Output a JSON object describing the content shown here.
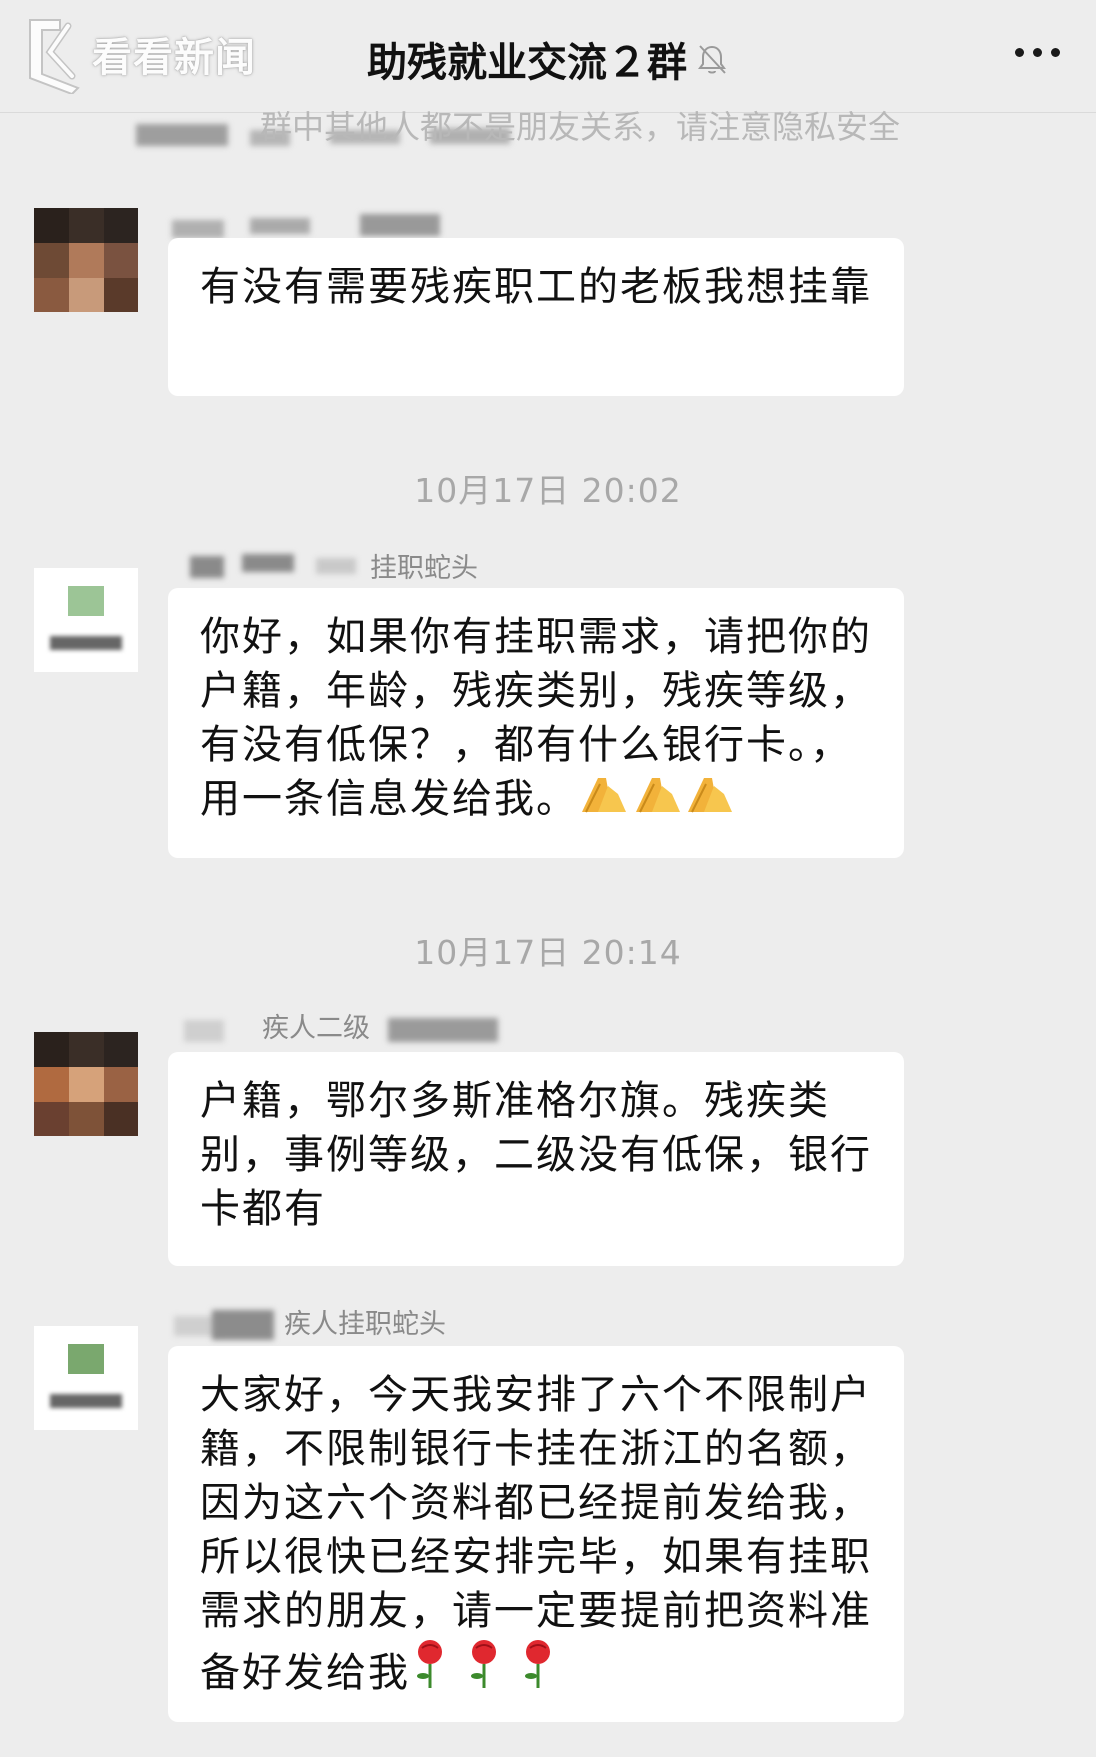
{
  "watermark": {
    "text": "看看新闻"
  },
  "header": {
    "title": "助残就业交流２群"
  },
  "notice": {
    "text": "群中其他人都不是朋友关系，请注意隐私安全"
  },
  "messages": [
    {
      "sender": "",
      "text": "有没有需要残疾职工的老板我想挂靠"
    },
    {
      "timestamp": "10月17日 20:02",
      "sender": "挂职蛇头",
      "text": "你好，如果你有挂职需求，请把你的户籍，年龄，残疾类别，残疾等级，有没有低保？，都有什么银行卡。，用一条信息发给我。"
    },
    {
      "timestamp": "10月17日 20:14",
      "sender": "疾人二级",
      "text": "户籍，鄂尔多斯准格尔旗。残疾类别，事例等级，二级没有低保，银行卡都有"
    },
    {
      "sender": "疾人挂职蛇头",
      "text": "大家好，今天我安排了六个不限制户籍，不限制银行卡挂在浙江的名额，因为这六个资料都已经提前发给我，所以很快已经安排完毕，如果有挂职需求的朋友，请一定要提前把资料准备好发给我"
    }
  ],
  "icons": {
    "back": "back-arrow-logo-icon",
    "mute": "bell-muted-icon",
    "more": "more-dots-icon",
    "pray": "folded-hands-emoji",
    "rose": "rose-emoji"
  },
  "colors": {
    "background": "#ededed",
    "bubble": "#ffffff",
    "text": "#111111",
    "meta": "#a8a8a8"
  }
}
